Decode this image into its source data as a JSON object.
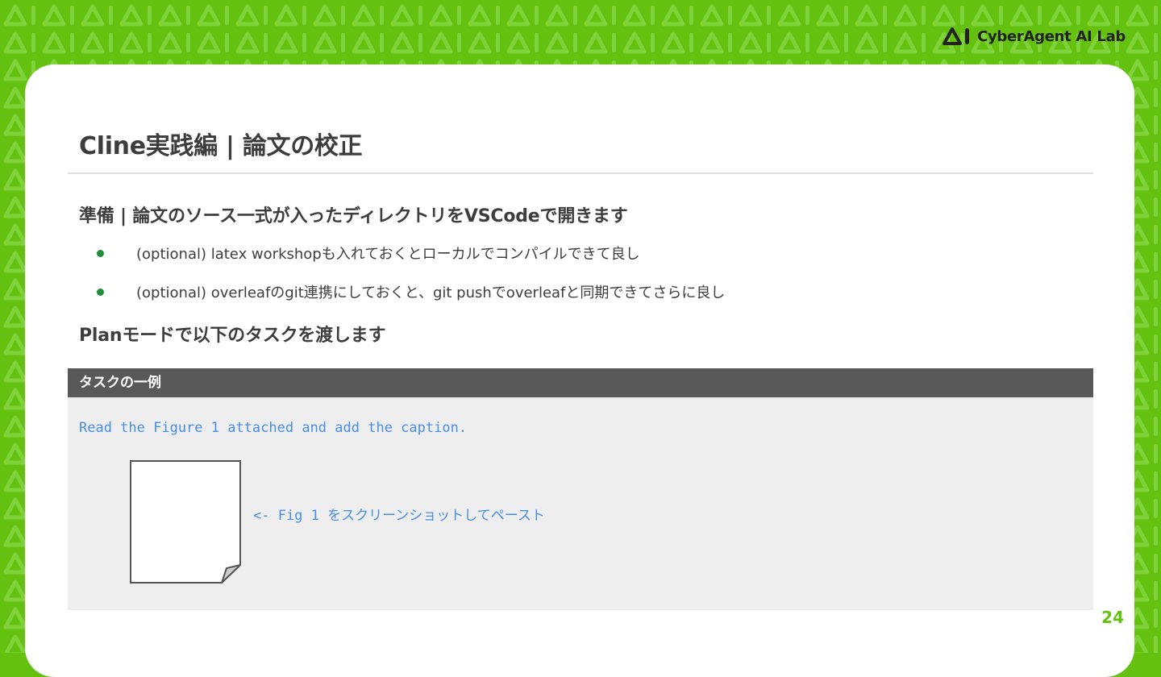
{
  "brand": {
    "name": "CyberAgent AI Lab"
  },
  "colors": {
    "accent": "#64c110",
    "bullet": "#1f8f3a",
    "code": "#4a8ee0",
    "header_bg": "#595959"
  },
  "slide": {
    "title": "Cline実践編 | 論文の校正",
    "section1": "準備 | 論文のソース一式が入ったディレクトリをVSCodeで開きます",
    "bullets": [
      "(optional) latex workshopも入れておくとローカルでコンパイルできて良し",
      "(optional) overleafのgit連携にしておくと、git pushでoverleafと同期できてさらに良し"
    ],
    "section2": "Planモードで以下のタスクを渡します",
    "task": {
      "header": "タスクの一例",
      "code_line": "Read the Figure 1 attached and add the caption.",
      "fig_note": "<- Fig 1 をスクリーンショットしてペースト"
    },
    "page_number": "24"
  }
}
